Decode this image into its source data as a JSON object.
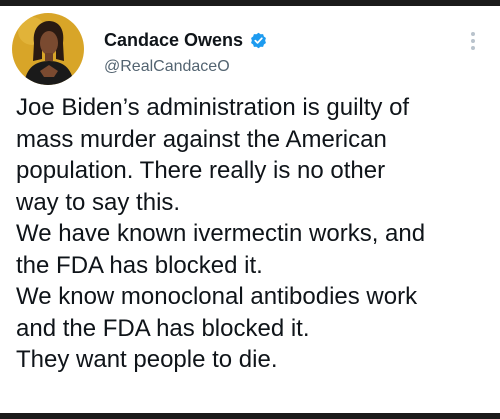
{
  "author": {
    "display_name": "Candace Owens",
    "handle": "@RealCandaceO",
    "verified": true,
    "avatar_icon": "profile-photo",
    "verified_icon": "verified-badge-icon"
  },
  "tweet": {
    "text": "Joe Biden’s administration is guilty of\nmass murder against the American\npopulation. There really is no other\nway to say this.\nWe have known ivermectin works, and\nthe FDA has blocked it.\nWe know monoclonal antibodies work\nand the FDA has blocked it.\nThey want people to die."
  },
  "actions": {
    "more_icon": "vertical-ellipsis-icon"
  },
  "colors": {
    "verified_blue": "#1d9bf0",
    "text_primary": "#0f1419",
    "text_secondary": "#536471",
    "avatar_bg": "#d8a528"
  }
}
